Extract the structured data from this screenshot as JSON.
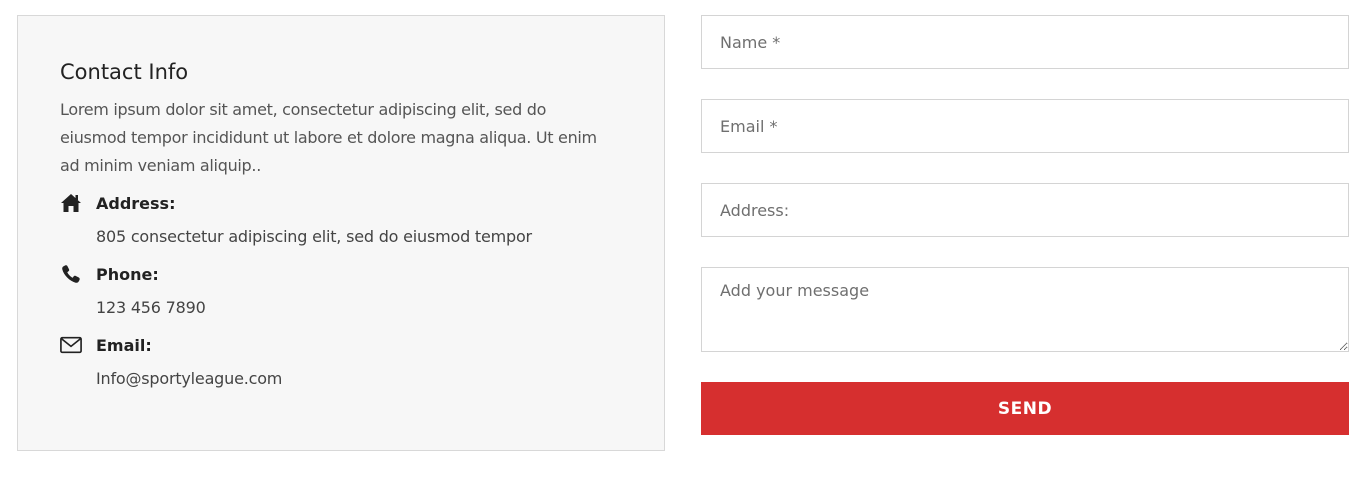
{
  "contact_info": {
    "title": "Contact Info",
    "description": "Lorem ipsum dolor sit amet, consectetur adipiscing elit, sed do eiusmod tempor incididunt ut labore et dolore magna aliqua. Ut enim ad minim veniam aliquip..",
    "items": [
      {
        "icon": "home-icon",
        "label": "Address:",
        "value": "805 consectetur adipiscing elit, sed do eiusmod tempor"
      },
      {
        "icon": "phone-icon",
        "label": "Phone:",
        "value": "123 456 7890"
      },
      {
        "icon": "envelope-icon",
        "label": "Email:",
        "value": "Info@sportyleague.com"
      }
    ]
  },
  "form": {
    "name_placeholder": "Name *",
    "email_placeholder": "Email *",
    "address_placeholder": "Address:",
    "message_placeholder": "Add your message",
    "send_label": "SEND"
  },
  "colors": {
    "accent": "#d62f2f",
    "card_background": "#f7f7f7"
  }
}
